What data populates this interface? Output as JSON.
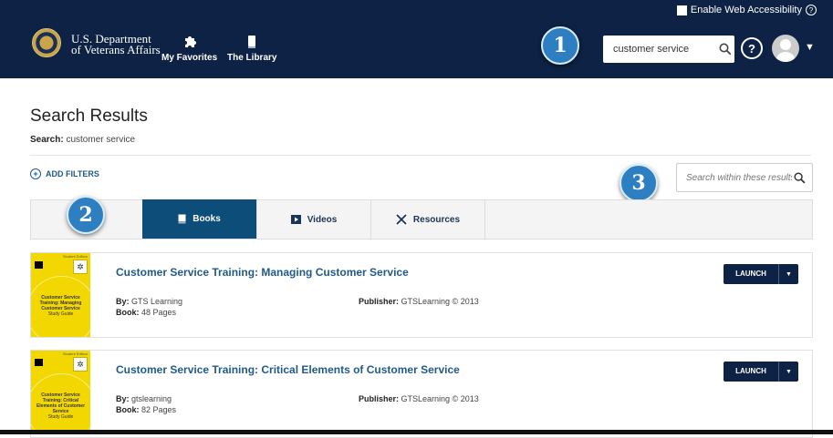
{
  "header": {
    "accessibility_label": "Enable Web Accessibility",
    "dept_line1": "U.S. Department",
    "dept_line2": "of Veterans Affairs",
    "nav": [
      {
        "label": "My Favorites",
        "icon": "puzzle-icon"
      },
      {
        "label": "The Library",
        "icon": "book-icon"
      }
    ],
    "search_value": "customer service",
    "help_label": "?",
    "caret": "▼"
  },
  "annotations": [
    "1",
    "2",
    "3"
  ],
  "page": {
    "title": "Search Results",
    "search_label": "Search:",
    "search_query": "customer service",
    "add_filters": "ADD FILTERS",
    "within_placeholder": "Search within these results"
  },
  "tabs": [
    {
      "label": "Books",
      "icon": "book-icon",
      "active": true
    },
    {
      "label": "Videos",
      "icon": "video-icon",
      "active": false
    },
    {
      "label": "Resources",
      "icon": "tools-icon",
      "active": false
    }
  ],
  "results": [
    {
      "title": "Customer Service Training: Managing Customer Service",
      "by_label": "By:",
      "by": "GTS Learning",
      "book_label": "Book:",
      "pages": "48 Pages",
      "publisher_label": "Publisher:",
      "publisher": "GTSLearning © 2013",
      "cover_title": "Customer Service Training: Managing Customer Service",
      "cover_sub": "Study Guide",
      "cover_edition": "Student Edition",
      "launch": "LAUNCH"
    },
    {
      "title": "Customer Service Training: Critical Elements of Customer Service",
      "by_label": "By:",
      "by": "gtslearning",
      "book_label": "Book:",
      "pages": "82 Pages",
      "publisher_label": "Publisher:",
      "publisher": "GTSLearning © 2013",
      "cover_title": "Customer Service Training: Critical Elements of Customer Service",
      "cover_sub": "Study Guide",
      "cover_edition": "Student Edition",
      "launch": "LAUNCH"
    }
  ],
  "colors": {
    "header_bg": "#0d2244",
    "accent": "#0d4d79",
    "link": "#1f5a8a",
    "annotation": "#2e7fc1"
  }
}
